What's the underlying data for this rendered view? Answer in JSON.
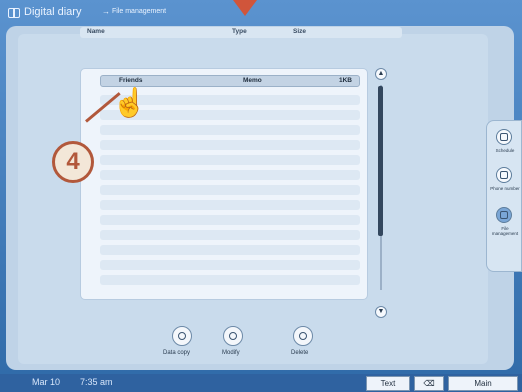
{
  "app": {
    "title": "Digital diary",
    "breadcrumb_sep": "→",
    "breadcrumb": "File management"
  },
  "table": {
    "headers": [
      "Name",
      "Type",
      "Size"
    ],
    "rows": [
      {
        "name": "Friends",
        "type": "Memo",
        "size": "1KB"
      }
    ]
  },
  "actions": [
    {
      "label": "Data copy",
      "icon": "copy-icon"
    },
    {
      "label": "Modify",
      "icon": "modify-icon"
    },
    {
      "label": "Delete",
      "icon": "delete-icon"
    }
  ],
  "sidebar": [
    {
      "label": "Schedule",
      "icon": "calendar-icon"
    },
    {
      "label": "Phone number",
      "icon": "phone-icon"
    },
    {
      "label": "File management",
      "icon": "folder-icon"
    }
  ],
  "callout": {
    "number": "4"
  },
  "status": {
    "date": "Mar 10",
    "time": "7:35 am",
    "buttons": [
      "Text",
      "⌫",
      "Main"
    ]
  },
  "colors": {
    "accent": "#b2583b",
    "background": "#2f6aa8"
  }
}
